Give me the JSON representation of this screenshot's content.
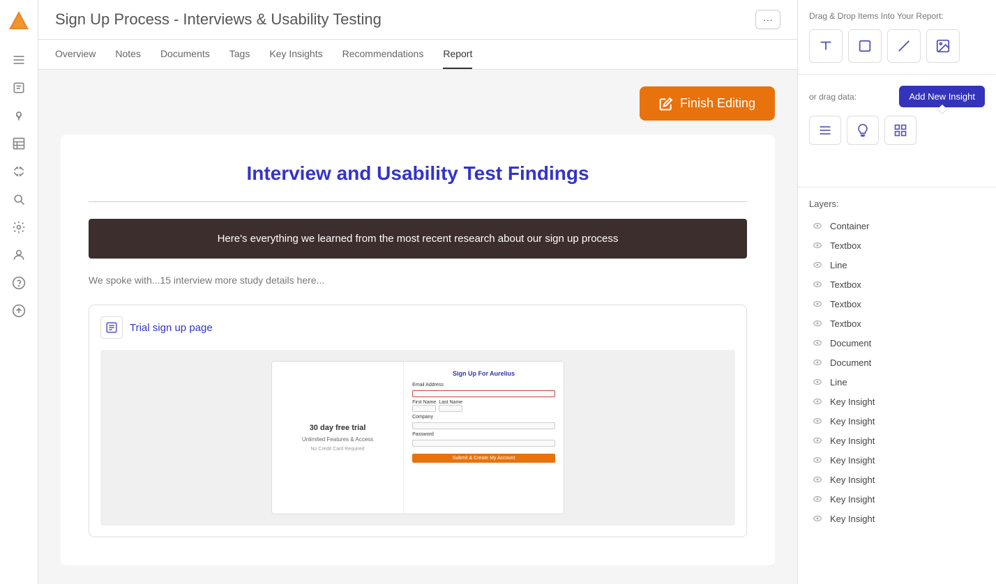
{
  "app": {
    "logo_label": "Aurelius",
    "title": "Sign Up Process - Interviews & Usability Testing",
    "more_button_label": "···"
  },
  "nav": {
    "tabs": [
      {
        "id": "overview",
        "label": "Overview",
        "active": false
      },
      {
        "id": "notes",
        "label": "Notes",
        "active": false
      },
      {
        "id": "documents",
        "label": "Documents",
        "active": false
      },
      {
        "id": "tags",
        "label": "Tags",
        "active": false
      },
      {
        "id": "key-insights",
        "label": "Key Insights",
        "active": false
      },
      {
        "id": "recommendations",
        "label": "Recommendations",
        "active": false
      },
      {
        "id": "report",
        "label": "Report",
        "active": true
      }
    ]
  },
  "toolbar": {
    "finish_editing_label": "Finish Editing",
    "drag_drop_label": "Drag & Drop Items Into Your Report:",
    "or_drag_data_label": "or drag data:",
    "add_new_insight_label": "Add New Insight"
  },
  "report": {
    "title": "Interview and Usability Test Findings",
    "banner_text": "Here's everything we learned from the most recent research about our sign up process",
    "body_text": "We spoke with...15 interview\nmore study details here...",
    "doc_card": {
      "title": "Trial sign up page",
      "signup_title": "Sign Up For Aurelius",
      "trial_title": "30 day free trial",
      "trial_features": "Unlimited Features & Access",
      "trial_note": "No Credit Card Required"
    }
  },
  "layers": {
    "title": "Layers:",
    "items": [
      {
        "id": "container",
        "name": "Container"
      },
      {
        "id": "textbox-1",
        "name": "Textbox"
      },
      {
        "id": "line-1",
        "name": "Line"
      },
      {
        "id": "textbox-2",
        "name": "Textbox"
      },
      {
        "id": "textbox-3",
        "name": "Textbox"
      },
      {
        "id": "textbox-4",
        "name": "Textbox"
      },
      {
        "id": "document-1",
        "name": "Document"
      },
      {
        "id": "document-2",
        "name": "Document"
      },
      {
        "id": "line-2",
        "name": "Line"
      },
      {
        "id": "key-insight-1",
        "name": "Key Insight"
      },
      {
        "id": "key-insight-2",
        "name": "Key Insight"
      },
      {
        "id": "key-insight-3",
        "name": "Key Insight"
      },
      {
        "id": "key-insight-4",
        "name": "Key Insight"
      },
      {
        "id": "key-insight-5",
        "name": "Key Insight"
      },
      {
        "id": "key-insight-6",
        "name": "Key Insight"
      },
      {
        "id": "key-insight-7",
        "name": "Key Insight"
      }
    ]
  },
  "sidebar": {
    "icons": [
      {
        "id": "menu",
        "label": "menu-icon"
      },
      {
        "id": "notes",
        "label": "notes-icon"
      },
      {
        "id": "insights",
        "label": "insights-icon"
      },
      {
        "id": "reports",
        "label": "reports-icon"
      },
      {
        "id": "data",
        "label": "data-icon"
      },
      {
        "id": "arrows",
        "label": "arrows-icon"
      },
      {
        "id": "search",
        "label": "search-icon"
      },
      {
        "id": "settings",
        "label": "settings-icon"
      },
      {
        "id": "person",
        "label": "person-icon"
      },
      {
        "id": "help",
        "label": "help-icon"
      },
      {
        "id": "export",
        "label": "export-icon"
      }
    ]
  }
}
